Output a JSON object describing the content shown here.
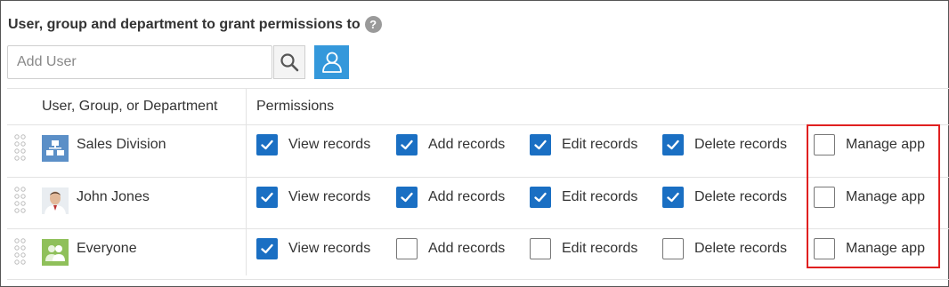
{
  "heading": "User, group and department to grant permissions to",
  "help_glyph": "?",
  "search": {
    "placeholder": "Add User"
  },
  "columns": {
    "entity": "User, Group, or Department",
    "permissions": "Permissions"
  },
  "permission_labels": [
    "View records",
    "Add records",
    "Edit records",
    "Delete records",
    "Manage app"
  ],
  "rows": [
    {
      "name": "Sales Division",
      "avatar": "department-icon",
      "checked": [
        true,
        true,
        true,
        true,
        false
      ]
    },
    {
      "name": "John Jones",
      "avatar": "user-photo",
      "checked": [
        true,
        true,
        true,
        true,
        false
      ]
    },
    {
      "name": "Everyone",
      "avatar": "group-icon",
      "checked": [
        true,
        false,
        false,
        false,
        false
      ]
    }
  ],
  "colors": {
    "accent": "#3498db",
    "checkbox": "#1a6fc3",
    "highlight": "#e02020"
  }
}
